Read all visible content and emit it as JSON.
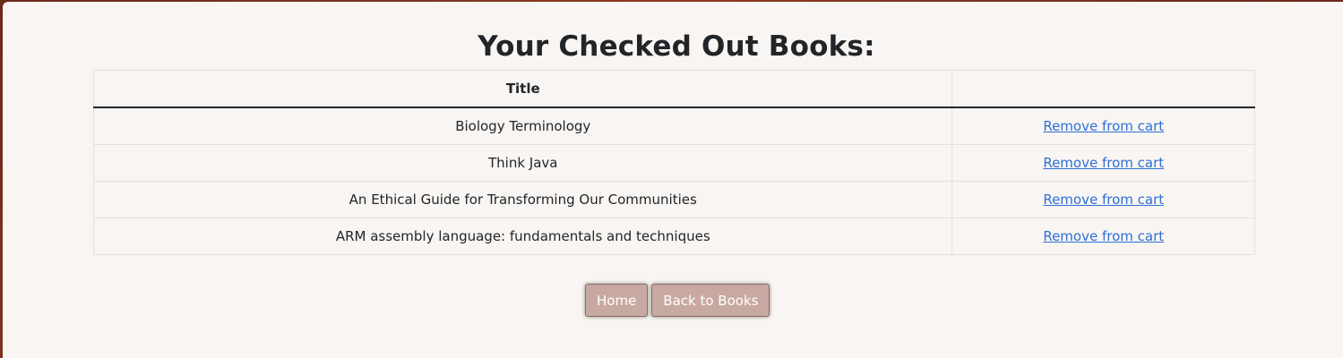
{
  "page": {
    "title": "Your Checked Out Books:"
  },
  "table": {
    "headers": [
      "Title",
      ""
    ],
    "rows": [
      {
        "title": "Biology Terminology",
        "action": "Remove from cart"
      },
      {
        "title": "Think Java",
        "action": "Remove from cart"
      },
      {
        "title": "An Ethical Guide for Transforming Our Communities",
        "action": "Remove from cart"
      },
      {
        "title": "ARM assembly language: fundamentals and techniques",
        "action": "Remove from cart"
      }
    ]
  },
  "buttons": {
    "home_label": "Home",
    "back_label": "Back to Books"
  },
  "colors": {
    "button_bg": "#c8a9a1",
    "link": "#2f6fd6",
    "card_bg": "#f8f5f2"
  }
}
